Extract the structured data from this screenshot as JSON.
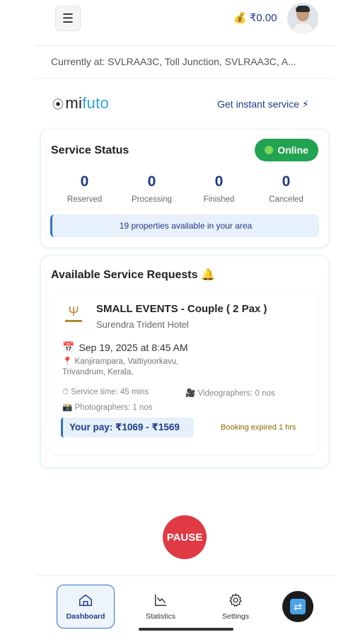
{
  "header": {
    "menu_icon": "hamburger-icon",
    "balance_icon": "money-bag-icon",
    "balance": "₹0.00",
    "avatar": "user-avatar"
  },
  "location": "Currently at: SVLRAA3C, Toll Junction, SVLRAA3C, A...",
  "brand": {
    "logo_mi": "mi",
    "logo_futo": "futo",
    "instant_service": "Get instant service ⚡"
  },
  "service_status": {
    "title": "Service Status",
    "online_label": "Online",
    "stats": [
      {
        "value": "0",
        "label": "Reserved"
      },
      {
        "value": "0",
        "label": "Processing"
      },
      {
        "value": "0",
        "label": "Finished"
      },
      {
        "value": "0",
        "label": "Canceled"
      }
    ],
    "properties_banner": "19 properties available in your area"
  },
  "requests": {
    "title": "Available Service Requests 🔔",
    "items": [
      {
        "title": "SMALL EVENTS - Couple  ( 2 Pax )",
        "hotel": "Surendra Trident Hotel",
        "date": "Sep 19, 2025 at 8:45 AM",
        "address_line1": "Kanjirampara, Vattiyoorkavu,",
        "address_line2": "Trivandrum, Kerala,",
        "service_time": "⏱ Service time: 45 mins",
        "videographers": "🎥 Videographers: 0 nos",
        "photographers": "📸 Photographers: 1 nos",
        "pay": "Your pay: ₹1069 - ₹1569",
        "expiry": "Booking expired 1 hrs"
      }
    ]
  },
  "pause_label": "PAUSE",
  "nav": {
    "dashboard": "Dashboard",
    "statistics": "Statistics",
    "settings": "Settings"
  },
  "colors": {
    "accent": "#1f3a8a",
    "online": "#22a352",
    "pause": "#e03a45",
    "brand_blue": "#2fa3d8"
  }
}
